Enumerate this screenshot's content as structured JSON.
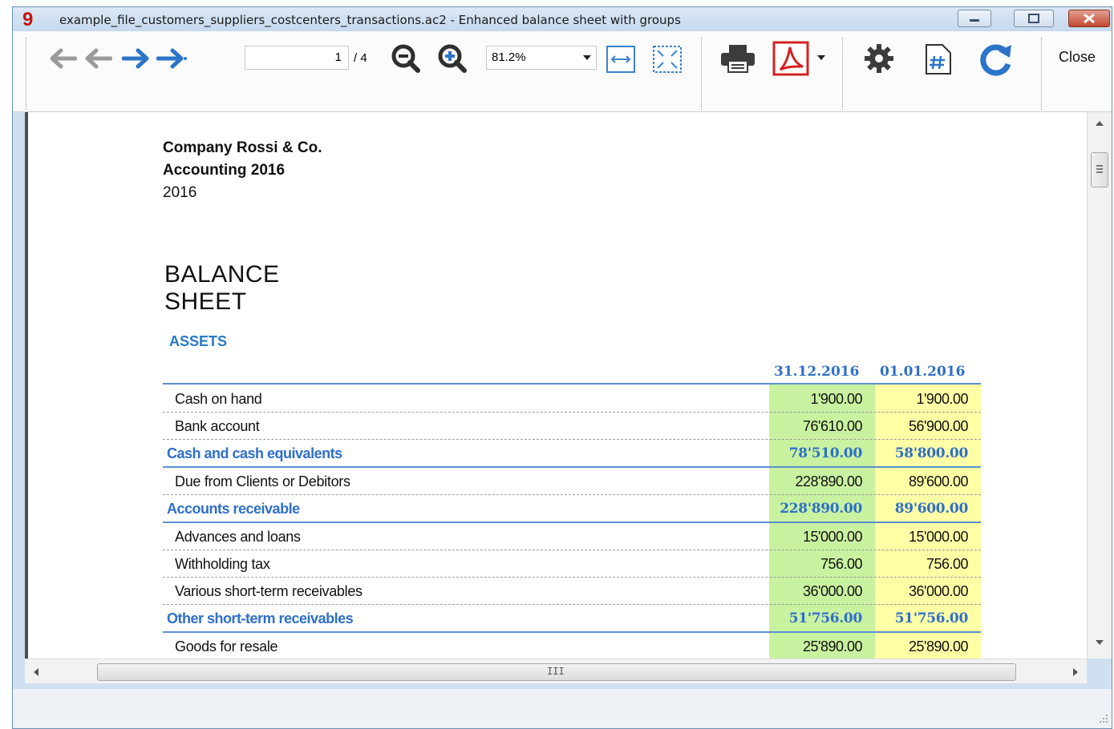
{
  "window": {
    "app_logo": "9",
    "title": "example_file_customers_suppliers_costcenters_transactions.ac2 - Enhanced balance sheet with groups"
  },
  "toolbar": {
    "icons": [
      "first-page-icon",
      "previous-page-icon",
      "next-page-icon",
      "last-page-icon",
      "zoom-out-icon",
      "zoom-in-icon",
      "fit-width-icon",
      "fit-page-icon",
      "print-icon",
      "pdf-icon",
      "settings-icon",
      "page-number-icon",
      "refresh-icon"
    ],
    "page_current": "1",
    "page_total": "/ 4",
    "zoom_value": "81.2%",
    "close_label": "Close"
  },
  "report": {
    "company": "Company Rossi & Co.",
    "subtitle": "Accounting 2016",
    "year": "2016",
    "title": "BALANCE SHEET",
    "section": "ASSETS",
    "columns": [
      "31.12.2016",
      "01.01.2016"
    ],
    "rows": [
      {
        "label": "Cash on hand",
        "v1": "1'900.00",
        "v2": "1'900.00",
        "kind": "detail"
      },
      {
        "label": "Bank account",
        "v1": "76'610.00",
        "v2": "56'900.00",
        "kind": "detail"
      },
      {
        "label": "Cash and cash equivalents",
        "v1": "78'510.00",
        "v2": "58'800.00",
        "kind": "total"
      },
      {
        "label": "Due from Clients or Debitors",
        "v1": "228'890.00",
        "v2": "89'600.00",
        "kind": "detail"
      },
      {
        "label": "Accounts receivable",
        "v1": "228'890.00",
        "v2": "89'600.00",
        "kind": "total"
      },
      {
        "label": "Advances and loans",
        "v1": "15'000.00",
        "v2": "15'000.00",
        "kind": "detail"
      },
      {
        "label": "Withholding tax",
        "v1": "756.00",
        "v2": "756.00",
        "kind": "detail"
      },
      {
        "label": "Various short-term receivables",
        "v1": "36'000.00",
        "v2": "36'000.00",
        "kind": "detail"
      },
      {
        "label": "Other short-term receivables",
        "v1": "51'756.00",
        "v2": "51'756.00",
        "kind": "total"
      },
      {
        "label": "Goods for resale",
        "v1": "25'890.00",
        "v2": "25'890.00",
        "kind": "detail"
      }
    ]
  },
  "scrollbar": {
    "h_grip": "III"
  },
  "colors": {
    "accent_blue": "#2e6fc8",
    "current_year_column": "#c9f2a0",
    "previous_year_column": "#ffffa6",
    "pdf_red": "#d32222"
  }
}
